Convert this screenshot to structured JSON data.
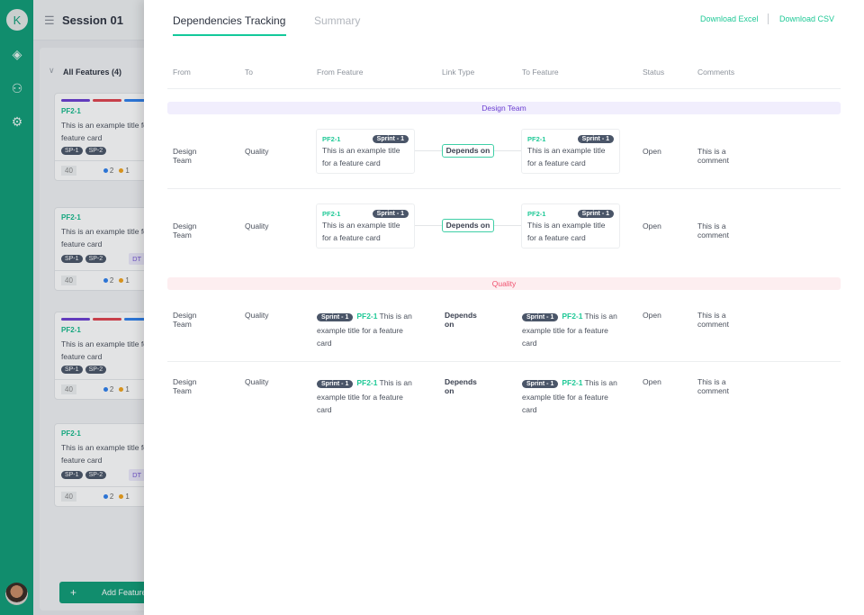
{
  "sidebar": {
    "avatar_letter": "K",
    "icons": [
      "layers-icon",
      "add-user-icon",
      "settings-icon"
    ]
  },
  "board": {
    "session_title": "Session 01",
    "all_features": "All Features (4)",
    "add_feature": "Add Feature",
    "cards": [
      {
        "id": "PF2-1",
        "title": "This is an example title for a",
        "title2": "feature card",
        "tags": [
          "SP-1",
          "SP-2"
        ],
        "dt": "",
        "bars": [
          "#6c3fd1",
          "#e0434f",
          "#2f80ed"
        ],
        "points": "40",
        "blue": "2",
        "orange": "1",
        "state": "In"
      },
      {
        "id": "PF2-1",
        "title": "This is an example title for a",
        "title2": "feature card",
        "tags": [
          "SP-1",
          "SP-2"
        ],
        "dt": "DT",
        "bars": [],
        "points": "40",
        "blue": "2",
        "orange": "1",
        "state": "In"
      },
      {
        "id": "PF2-1",
        "title": "This is an example title for a",
        "title2": "feature card",
        "tags": [
          "SP-1",
          "SP-2"
        ],
        "dt": "",
        "bars": [
          "#6c3fd1",
          "#e0434f",
          "#2f80ed"
        ],
        "points": "40",
        "blue": "2",
        "orange": "1",
        "state": "In"
      },
      {
        "id": "PF2-1",
        "title": "This is an example title for a",
        "title2": "feature card",
        "tags": [
          "SP-1",
          "SP-2"
        ],
        "dt": "DT",
        "bars": [],
        "points": "40",
        "blue": "2",
        "orange": "1",
        "state": "In"
      }
    ]
  },
  "drawer": {
    "tabs": [
      {
        "label": "Dependencies Tracking",
        "active": true
      },
      {
        "label": "Summary",
        "active": false
      }
    ],
    "download_excel": "Download Excel",
    "download_csv": "Download CSV",
    "columns": [
      "From",
      "To",
      "From Feature",
      "Link Type",
      "To Feature",
      "Status",
      "Comments"
    ],
    "groups": [
      {
        "name": "Design Team",
        "color": "#6c3fd1",
        "bg": "#f1eefd",
        "style": "boxed",
        "rows": [
          {
            "from": "Design Team",
            "to": "Quality",
            "from_feature": {
              "id": "PF2-1",
              "sprint": "Sprint - 1",
              "title": "This is an example title",
              "title2": "for a feature card"
            },
            "link": "Depends on",
            "to_feature": {
              "id": "PF2-1",
              "sprint": "Sprint - 1",
              "title": "This is an example title",
              "title2": "for a feature card"
            },
            "status": "Open",
            "comment": "This is a comment"
          },
          {
            "from": "Design Team",
            "to": "Quality",
            "from_feature": {
              "id": "PF2-1",
              "sprint": "Sprint - 1",
              "title": "This is an example title",
              "title2": "for a feature card"
            },
            "link": "Depends on",
            "to_feature": {
              "id": "PF2-1",
              "sprint": "Sprint - 1",
              "title": "This is an example title",
              "title2": "for a feature card"
            },
            "status": "Open",
            "comment": "This is a comment"
          }
        ]
      },
      {
        "name": "Quality",
        "color": "#f0506e",
        "bg": "#fdeef0",
        "style": "inline",
        "rows": [
          {
            "from": "Design Team",
            "to": "Quality",
            "from_feature": {
              "id": "PF2-1",
              "sprint": "Sprint - 1",
              "title": "This is an example title for a feature card"
            },
            "link": "Depends on",
            "to_feature": {
              "id": "PF2-1",
              "sprint": "Sprint - 1",
              "title": "This is an example title for a feature card"
            },
            "status": "Open",
            "comment": "This is a comment"
          },
          {
            "from": "Design Team",
            "to": "Quality",
            "from_feature": {
              "id": "PF2-1",
              "sprint": "Sprint - 1",
              "title": "This is an example title for a feature card"
            },
            "link": "Depends on",
            "to_feature": {
              "id": "PF2-1",
              "sprint": "Sprint - 1",
              "title": "This is an example title for a feature card"
            },
            "status": "Open",
            "comment": "This is a comment"
          }
        ]
      }
    ]
  }
}
